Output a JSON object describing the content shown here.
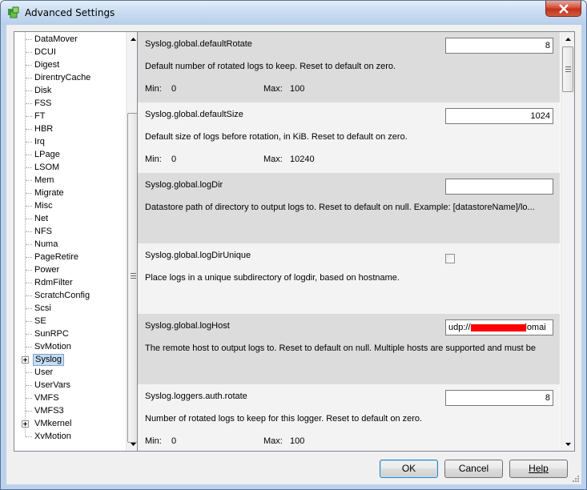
{
  "window": {
    "title": "Advanced Settings",
    "app_icon": "vsphere-logo-icon",
    "close_icon": "close-icon"
  },
  "tree": {
    "items": [
      {
        "label": "DataMover"
      },
      {
        "label": "DCUI"
      },
      {
        "label": "Digest"
      },
      {
        "label": "DirentryCache"
      },
      {
        "label": "Disk"
      },
      {
        "label": "FSS"
      },
      {
        "label": "FT"
      },
      {
        "label": "HBR"
      },
      {
        "label": "Irq"
      },
      {
        "label": "LPage"
      },
      {
        "label": "LSOM"
      },
      {
        "label": "Mem"
      },
      {
        "label": "Migrate"
      },
      {
        "label": "Misc"
      },
      {
        "label": "Net"
      },
      {
        "label": "NFS"
      },
      {
        "label": "Numa"
      },
      {
        "label": "PageRetire"
      },
      {
        "label": "Power"
      },
      {
        "label": "RdmFilter"
      },
      {
        "label": "ScratchConfig"
      },
      {
        "label": "Scsi"
      },
      {
        "label": "SE"
      },
      {
        "label": "SunRPC"
      },
      {
        "label": "SvMotion"
      },
      {
        "label": "Syslog",
        "expandable": true,
        "selected": true
      },
      {
        "label": "User"
      },
      {
        "label": "UserVars"
      },
      {
        "label": "VMFS"
      },
      {
        "label": "VMFS3"
      },
      {
        "label": "VMkernel",
        "expandable": true
      },
      {
        "label": "XvMotion"
      }
    ]
  },
  "settings": [
    {
      "name": "Syslog.global.defaultRotate",
      "value": "8",
      "description": "Default number of rotated logs to keep. Reset to default on zero.",
      "min_label": "Min:",
      "min": "0",
      "max_label": "Max:",
      "max": "100"
    },
    {
      "name": "Syslog.global.defaultSize",
      "value": "1024",
      "description": "Default size of logs before rotation, in KiB. Reset to default on zero.",
      "min_label": "Min:",
      "min": "0",
      "max_label": "Max:",
      "max": "10240"
    },
    {
      "name": "Syslog.global.logDir",
      "value": "",
      "description": "Datastore path of directory to output logs to. Reset to default on null. Example: [datastoreName]/lo..."
    },
    {
      "name": "Syslog.global.logDirUnique",
      "checked": false,
      "description": "Place logs in a unique subdirectory of logdir, based on hostname."
    },
    {
      "name": "Syslog.global.logHost",
      "value": "udp://                    .domai",
      "description": "The remote host to output logs to. Reset to default on null. Multiple hosts are supported and must be"
    },
    {
      "name": "Syslog.loggers.auth.rotate",
      "value": "8",
      "description": "Number of rotated logs to keep for this logger. Reset to default on zero.",
      "min_label": "Min:",
      "min": "0",
      "max_label": "Max:",
      "max": "100"
    }
  ],
  "buttons": {
    "ok": "OK",
    "cancel": "Cancel",
    "help": "Help"
  },
  "colors": {
    "title_gradient_top": "#e3eefa",
    "close_red": "#c2321b",
    "row_grey": "#dcdcdc",
    "row_light": "#f3f3f3",
    "selection": "#c5ddf6",
    "redaction": "#ff0000"
  }
}
